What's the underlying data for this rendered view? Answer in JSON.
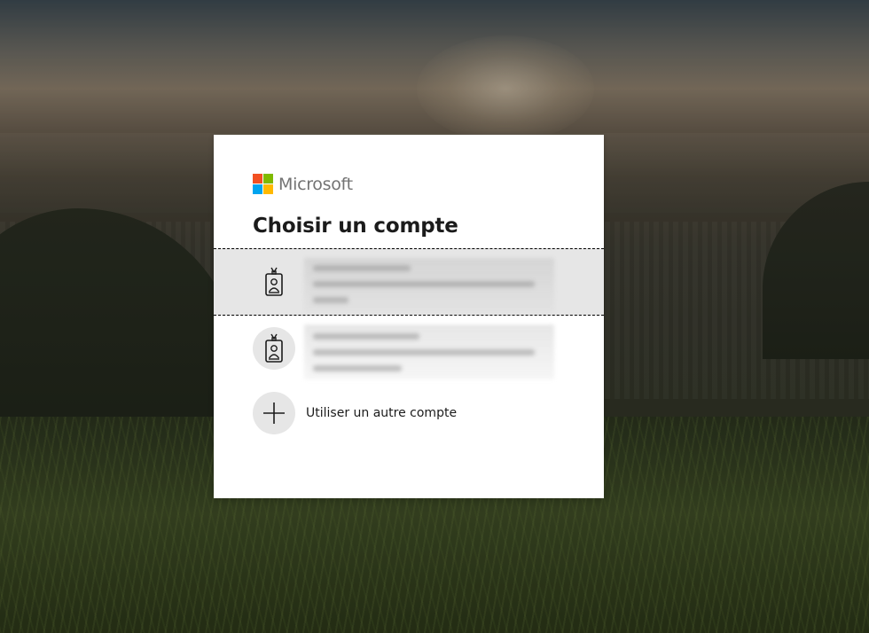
{
  "brand": {
    "name": "Microsoft",
    "colors": {
      "red": "#f25022",
      "green": "#7fba00",
      "blue": "#00a4ef",
      "yellow": "#ffb900"
    }
  },
  "dialog": {
    "title": "Choisir un compte",
    "accounts": [
      {
        "icon": "badge-icon",
        "selected": true,
        "details": ""
      },
      {
        "icon": "badge-icon",
        "selected": false,
        "details": ""
      }
    ],
    "other_account": {
      "icon": "plus-icon",
      "label": "Utiliser un autre compte"
    }
  }
}
